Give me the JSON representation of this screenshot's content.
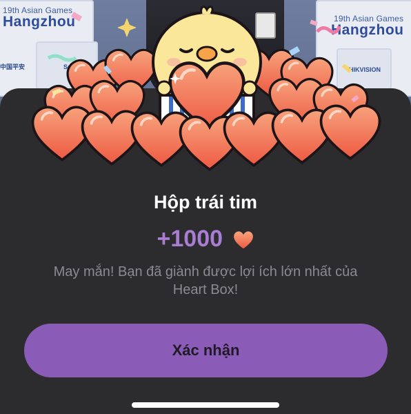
{
  "background": {
    "board_left_small": "19th Asian Games",
    "board_left_big": "Hangzhou",
    "board_right_small": "19th Asian Games",
    "board_right_big": "Hangzhou",
    "sponsor_1": "中国平安",
    "sponsor_2": "Sch",
    "sponsor_3": "HIKVISION"
  },
  "dialog": {
    "title": "Hộp trái tim",
    "reward_amount": "+1000",
    "reward_icon": "heart-icon",
    "description_line1": "May mắn! Bạn đã giành được lợi ích lớn nhất của",
    "description_line2": "Heart Box!",
    "confirm_label": "Xác nhận"
  },
  "colors": {
    "sheet_background": "#2c2b2e",
    "accent_purple": "#8b5bb8",
    "reward_text": "#a97ed2",
    "heart": "#f06a4e"
  }
}
